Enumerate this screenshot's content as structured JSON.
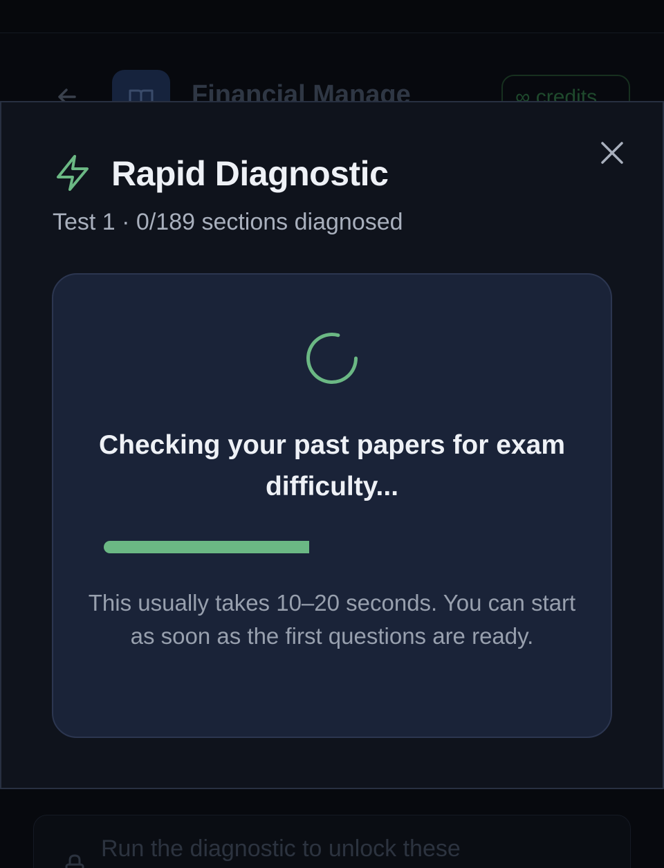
{
  "background": {
    "title": "Financial Manage",
    "credits_label": "∞ credits",
    "lock_message": "Run the diagnostic to unlock these"
  },
  "modal": {
    "title": "Rapid Diagnostic",
    "subtitle": "Test 1 · 0/189 sections diagnosed",
    "status": {
      "heading": "Checking your past papers for exam difficulty...",
      "progress": 0.45,
      "note": "This usually takes 10–20 seconds. You can start as soon as the first questions are ready."
    }
  },
  "colors": {
    "accent": "#6bb884",
    "modal_bg": "#0f131c",
    "card_bg": "#1a2338"
  },
  "icons": {
    "back": "arrow-left-icon",
    "book": "book-icon",
    "close": "close-icon",
    "bolt": "bolt-icon",
    "spinner": "loading-spinner-icon",
    "lock": "lock-icon"
  }
}
